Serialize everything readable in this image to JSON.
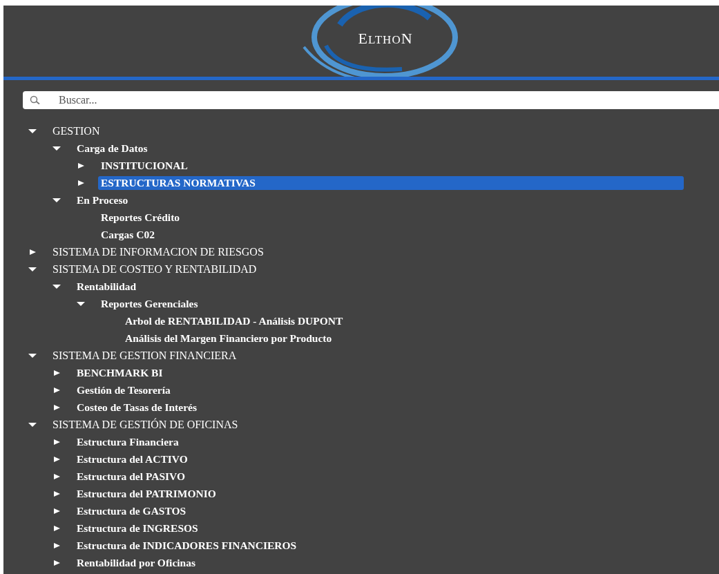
{
  "logo": {
    "text": "ELTHON"
  },
  "search": {
    "placeholder": "Buscar..."
  },
  "tree": [
    {
      "label": "GESTION",
      "kind": "branch",
      "expanded": true,
      "selected": false,
      "children": [
        {
          "label": "Carga de Datos",
          "kind": "branch",
          "expanded": true,
          "selected": false,
          "children": [
            {
              "label": "INSTITUCIONAL",
              "kind": "branch",
              "expanded": false,
              "selected": false
            },
            {
              "label": "ESTRUCTURAS NORMATIVAS",
              "kind": "branch",
              "expanded": false,
              "selected": true
            }
          ]
        },
        {
          "label": "En Proceso",
          "kind": "branch",
          "expanded": true,
          "selected": false,
          "children": [
            {
              "label": "Reportes Crédito",
              "kind": "leaf",
              "selected": false
            },
            {
              "label": "Cargas C02",
              "kind": "leaf",
              "selected": false
            }
          ]
        }
      ]
    },
    {
      "label": "SISTEMA DE INFORMACION DE RIESGOS",
      "kind": "branch",
      "expanded": false,
      "selected": false
    },
    {
      "label": "SISTEMA DE COSTEO Y RENTABILIDAD",
      "kind": "branch",
      "expanded": true,
      "selected": false,
      "children": [
        {
          "label": "Rentabilidad",
          "kind": "branch",
          "expanded": true,
          "selected": false,
          "children": [
            {
              "label": "Reportes Gerenciales",
              "kind": "branch",
              "expanded": true,
              "selected": false,
              "children": [
                {
                  "label": "Arbol de RENTABILIDAD - Análisis DUPONT",
                  "kind": "leaf",
                  "selected": false
                },
                {
                  "label": "Análisis del Margen Financiero por Producto",
                  "kind": "leaf",
                  "selected": false
                }
              ]
            }
          ]
        }
      ]
    },
    {
      "label": "SISTEMA DE GESTION FINANCIERA",
      "kind": "branch",
      "expanded": true,
      "selected": false,
      "children": [
        {
          "label": "BENCHMARK BI",
          "kind": "branch",
          "expanded": false,
          "selected": false
        },
        {
          "label": "Gestión de Tesorería",
          "kind": "branch",
          "expanded": false,
          "selected": false
        },
        {
          "label": "Costeo de Tasas de Interés",
          "kind": "branch",
          "expanded": false,
          "selected": false
        }
      ]
    },
    {
      "label": "SISTEMA DE GESTIÓN DE OFICINAS",
      "kind": "branch",
      "expanded": true,
      "selected": false,
      "children": [
        {
          "label": "Estructura Financiera",
          "kind": "branch",
          "expanded": false,
          "selected": false
        },
        {
          "label": "Estructura del ACTIVO",
          "kind": "branch",
          "expanded": false,
          "selected": false
        },
        {
          "label": "Estructura del PASIVO",
          "kind": "branch",
          "expanded": false,
          "selected": false
        },
        {
          "label": "Estructura del PATRIMONIO",
          "kind": "branch",
          "expanded": false,
          "selected": false
        },
        {
          "label": "Estructura de GASTOS",
          "kind": "branch",
          "expanded": false,
          "selected": false
        },
        {
          "label": "Estructura de INGRESOS",
          "kind": "branch",
          "expanded": false,
          "selected": false
        },
        {
          "label": "Estructura de INDICADORES FINANCIEROS",
          "kind": "branch",
          "expanded": false,
          "selected": false
        },
        {
          "label": "Rentabilidad por Oficinas",
          "kind": "branch",
          "expanded": false,
          "selected": false
        }
      ]
    }
  ]
}
